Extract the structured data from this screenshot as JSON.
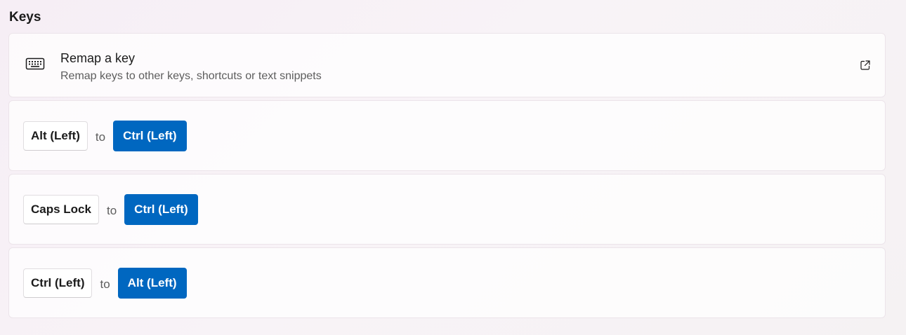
{
  "section": {
    "title": "Keys"
  },
  "remap": {
    "title": "Remap a key",
    "description": "Remap keys to other keys, shortcuts or text snippets",
    "icon": "keyboard-icon",
    "action_icon": "open-external-icon"
  },
  "mappings": [
    {
      "from": "Alt (Left)",
      "to_label": "to",
      "to": "Ctrl (Left)"
    },
    {
      "from": "Caps Lock",
      "to_label": "to",
      "to": "Ctrl (Left)"
    },
    {
      "from": "Ctrl (Left)",
      "to_label": "to",
      "to": "Alt (Left)"
    }
  ],
  "colors": {
    "accent": "#0067c0",
    "text": "#1b1b1b",
    "secondary_text": "#5d5d5d"
  }
}
